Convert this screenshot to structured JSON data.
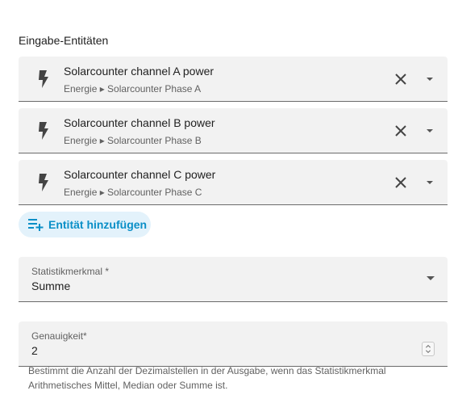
{
  "section": {
    "title": "Eingabe-Entitäten"
  },
  "entities": [
    {
      "name": "Solarcounter channel A power",
      "context": "Energie ▸ Solarcounter Phase A",
      "icon": "flash-icon"
    },
    {
      "name": "Solarcounter channel B power",
      "context": "Energie ▸ Solarcounter Phase B",
      "icon": "flash-icon"
    },
    {
      "name": "Solarcounter channel C power",
      "context": "Energie ▸ Solarcounter Phase C",
      "icon": "flash-icon"
    }
  ],
  "add_entity": {
    "label": "Entität hinzufügen",
    "icon": "playlist-plus-icon"
  },
  "statistic_field": {
    "label": "Statistikmerkmal *",
    "value": "Summe"
  },
  "precision_field": {
    "label": "Genauigkeit*",
    "value": "2"
  },
  "helper_text": "Bestimmt die Anzahl der Dezimalstellen in der Ausgabe, wenn das Statistikmerkmal Arithmetisches Mittel, Median oder Summe ist.",
  "colors": {
    "accent": "#0a8fc7",
    "chip_bg": "#e3f2fb",
    "field_bg": "#f2f2f2"
  }
}
